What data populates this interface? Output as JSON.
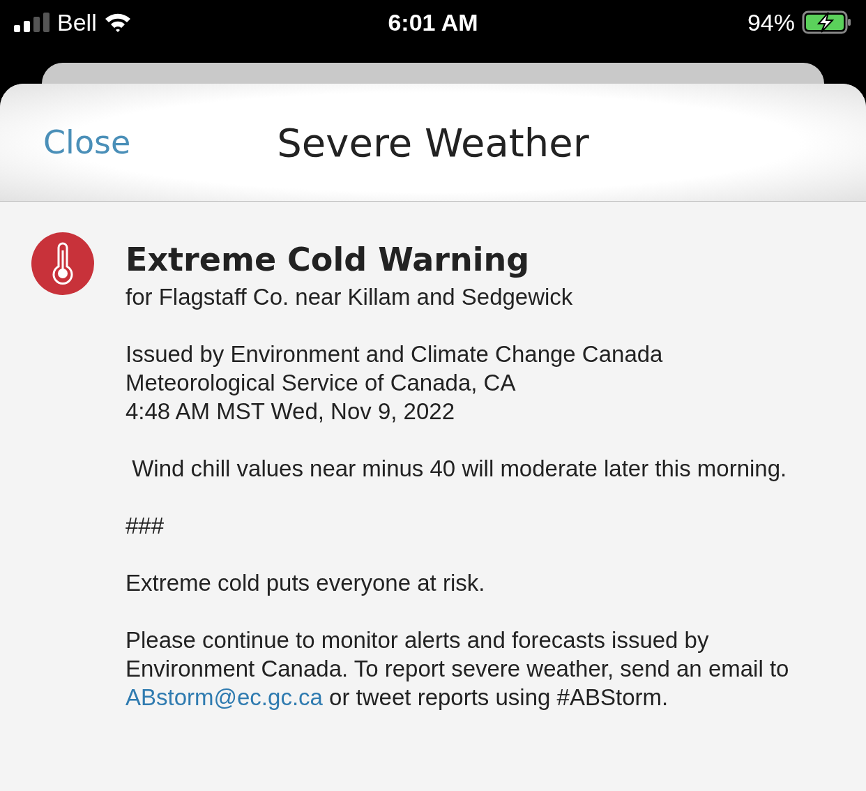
{
  "status_bar": {
    "carrier": "Bell",
    "time": "6:01 AM",
    "battery": "94%"
  },
  "header": {
    "close": "Close",
    "title": "Severe Weather"
  },
  "alert": {
    "title": "Extreme Cold Warning",
    "area": "for Flagstaff Co. near Killam and Sedgewick",
    "issued": [
      "Issued by Environment and Climate Change Canada",
      "Meteorological Service of Canada, CA",
      "4:48 AM MST Wed, Nov 9, 2022"
    ],
    "paragraphs": [
      {
        "kind": "text",
        "text": " Wind chill values near minus 40 will moderate later this morning."
      },
      {
        "kind": "text",
        "text": "###"
      },
      {
        "kind": "text",
        "text": "Extreme cold puts everyone at risk."
      },
      {
        "kind": "contact",
        "before": "Please continue to monitor alerts and forecasts issued by Environment Canada. To report severe weather, send an email to ",
        "link": "ABstorm@ec.gc.ca",
        "after": " or tweet reports using #ABStorm."
      }
    ]
  }
}
